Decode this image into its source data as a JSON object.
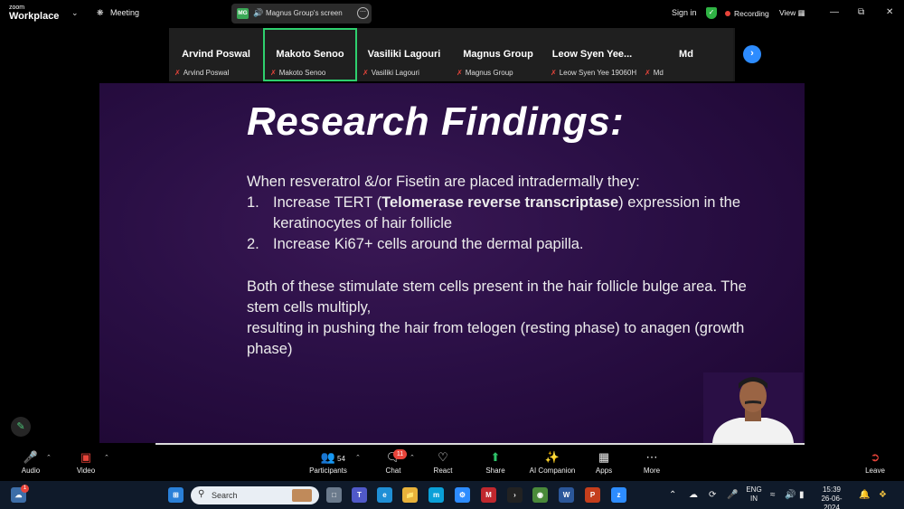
{
  "app": {
    "brand_small": "zoom",
    "brand_big": "Workplace",
    "meeting_label": "Meeting",
    "share_pill": {
      "badge": "MG",
      "label": "Magnus Group's screen"
    },
    "sign_in": "Sign in",
    "recording": "Recording",
    "view": "View"
  },
  "participants": [
    {
      "name": "Arvind Poswal",
      "sub": "Arvind Poswal",
      "active": false
    },
    {
      "name": "Makoto Senoo",
      "sub": "Makoto Senoo",
      "active": true
    },
    {
      "name": "Vasiliki Lagouri",
      "sub": "Vasiliki Lagouri",
      "active": false
    },
    {
      "name": "Magnus Group",
      "sub": "Magnus Group",
      "active": false
    },
    {
      "name": "Leow Syen Yee...",
      "sub": "Leow Syen Yee 19060H",
      "active": false
    },
    {
      "name": "Md",
      "sub": "Md",
      "active": false
    }
  ],
  "slide": {
    "title": "Research Findings:",
    "intro": "When resveratrol &/or Fisetin are placed intradermally they:",
    "items": [
      {
        "num": "1.",
        "pre": "Increase TERT (",
        "bold": "Telomerase reverse transcriptase",
        "post": ") expression in the keratinocytes of hair follicle"
      },
      {
        "num": "2.",
        "pre": "Increase Ki67+ cells around the dermal papilla.",
        "bold": "",
        "post": ""
      }
    ],
    "para1": "Both of these stimulate stem cells present in the hair follicle bulge area. The stem cells multiply,",
    "para2": "resulting in pushing the hair from telogen (resting phase) to anagen (growth phase)"
  },
  "toolbar": {
    "audio": "Audio",
    "video": "Video",
    "participants": "Participants",
    "participants_count": "54",
    "chat": "Chat",
    "chat_count": "11",
    "react": "React",
    "share": "Share",
    "ai_companion": "AI Companion",
    "apps": "Apps",
    "more": "More",
    "leave": "Leave"
  },
  "taskbar": {
    "search_placeholder": "Search",
    "weather_badge": "1",
    "lang_top": "ENG",
    "lang_bottom": "IN",
    "time": "15:39",
    "date": "26-06-2024"
  },
  "colors": {
    "accent_blue": "#2d8cff",
    "active_border": "#2ed06e",
    "mute_red": "#e8443a",
    "slide_purple": "#2a0f45"
  }
}
